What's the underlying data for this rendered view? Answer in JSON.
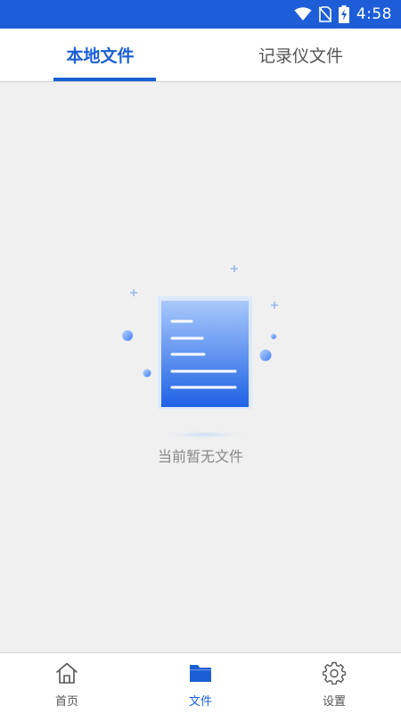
{
  "status_bar": {
    "time": "4:58",
    "background": "#1d5ed8",
    "icons": [
      "wifi-icon",
      "no-sim-icon",
      "battery-charging-icon"
    ]
  },
  "tabs": [
    {
      "label": "本地文件",
      "active": true
    },
    {
      "label": "记录仪文件",
      "active": false
    }
  ],
  "empty_state": {
    "message": "当前暂无文件",
    "illustration_icon": "document-icon"
  },
  "bottom_nav": [
    {
      "label": "首页",
      "icon": "home-icon",
      "active": false
    },
    {
      "label": "文件",
      "icon": "folder-icon",
      "active": true
    },
    {
      "label": "设置",
      "icon": "gear-icon",
      "active": false
    }
  ],
  "colors": {
    "accent": "#1a5fd4",
    "inactive_text": "#555555",
    "empty_text": "#888888",
    "background": "#f0f0f0"
  }
}
